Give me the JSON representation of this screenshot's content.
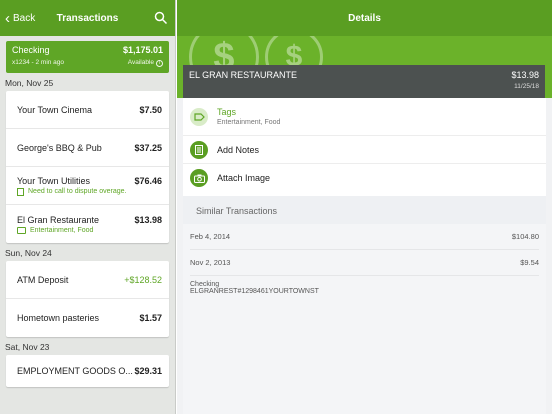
{
  "left": {
    "back_label": "Back",
    "title": "Transactions",
    "account": {
      "name": "Checking",
      "balance": "$1,175.01",
      "detail": "x1234 - 2 min ago",
      "status": "Available"
    },
    "groups": [
      {
        "date": "Mon, Nov 25",
        "items": [
          {
            "name": "Your Town Cinema",
            "amount": "$7.50"
          },
          {
            "name": "George's BBQ & Pub",
            "amount": "$37.25"
          },
          {
            "name": "Your Town Utilities",
            "amount": "$76.46",
            "note": "Need to call to dispute overage."
          },
          {
            "name": "El Gran Restaurante",
            "amount": "$13.98",
            "tags": "Entertainment, Food"
          }
        ]
      },
      {
        "date": "Sun, Nov 24",
        "items": [
          {
            "name": "ATM Deposit",
            "amount": "+$128.52"
          },
          {
            "name": "Hometown pasteries",
            "amount": "$1.57"
          }
        ]
      },
      {
        "date": "Sat, Nov 23",
        "items": [
          {
            "name": "EMPLOYMENT GOODS O...",
            "amount": "$29.31"
          }
        ]
      }
    ]
  },
  "right": {
    "title": "Details",
    "merchant": "EL GRAN RESTAURANTE",
    "amount": "$13.98",
    "date": "11/25/18",
    "tags_label": "Tags",
    "tags_value": "Entertainment, Food",
    "notes_label": "Add Notes",
    "image_label": "Attach Image",
    "similar_title": "Similar Transactions",
    "similar": [
      {
        "date": "Feb 4, 2014",
        "amount": "$104.80"
      },
      {
        "date": "Nov 2, 2013",
        "amount": "$9.54"
      }
    ],
    "account_name": "Checking",
    "raw_description": "ELGRANREST#1298461YOURTOWNST"
  },
  "colors": {
    "brand_green": "#5a9e22",
    "accent_green": "#5fa626",
    "merchant_bar": "#4c5150"
  },
  "icons": [
    "chevron-left-icon",
    "search-icon",
    "info-icon",
    "note-icon",
    "tag-icon",
    "document-icon",
    "camera-icon",
    "dollar-coin-icon"
  ]
}
